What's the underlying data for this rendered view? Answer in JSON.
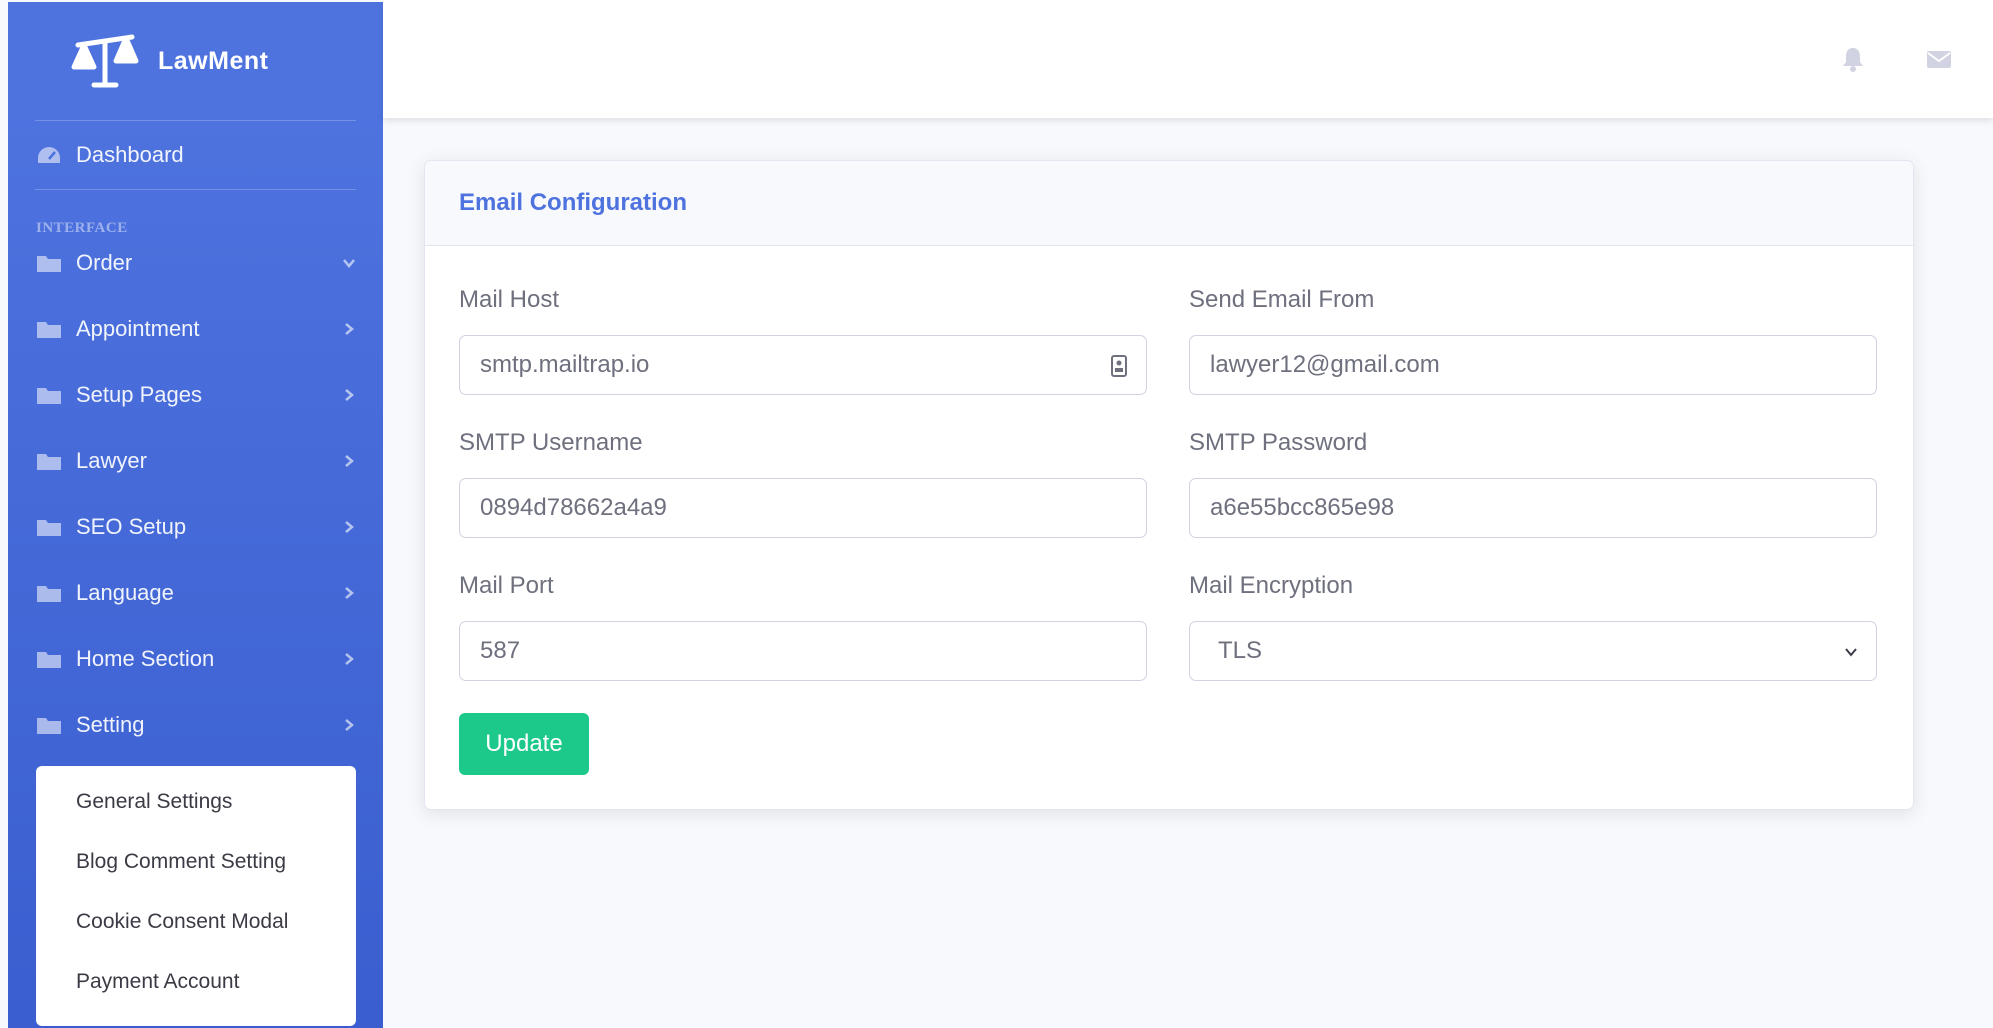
{
  "brand": {
    "name": "LawMent",
    "logo_icon": "scales-of-justice-icon"
  },
  "sidebar": {
    "dashboard_label": "Dashboard",
    "section_heading": "INTERFACE",
    "items": [
      {
        "label": "Order",
        "chevron": "down"
      },
      {
        "label": "Appointment",
        "chevron": "right"
      },
      {
        "label": "Setup Pages",
        "chevron": "right"
      },
      {
        "label": "Lawyer",
        "chevron": "right"
      },
      {
        "label": "SEO Setup",
        "chevron": "right"
      },
      {
        "label": "Language",
        "chevron": "right"
      },
      {
        "label": "Home Section",
        "chevron": "right"
      },
      {
        "label": "Setting",
        "chevron": "right"
      }
    ],
    "setting_submenu": [
      "General Settings",
      "Blog Comment Setting",
      "Cookie Consent Modal",
      "Payment Account"
    ]
  },
  "topbar": {
    "icons": [
      "bell-icon",
      "envelope-icon"
    ]
  },
  "card": {
    "title": "Email Configuration",
    "fields": {
      "mail_host": {
        "label": "Mail Host",
        "value": "smtp.mailtrap.io"
      },
      "send_email_from": {
        "label": "Send Email From",
        "value": "lawyer12@gmail.com"
      },
      "smtp_username": {
        "label": "SMTP Username",
        "value": "0894d78662a4a9"
      },
      "smtp_password": {
        "label": "SMTP Password",
        "value": "a6e55bcc865e98"
      },
      "mail_port": {
        "label": "Mail Port",
        "value": "587"
      },
      "mail_encryption": {
        "label": "Mail Encryption",
        "value": "TLS"
      }
    },
    "update_label": "Update"
  },
  "colors": {
    "sidebar_primary": "#4e73df",
    "accent_title": "#4e73df",
    "update_button": "#1cc88a"
  }
}
